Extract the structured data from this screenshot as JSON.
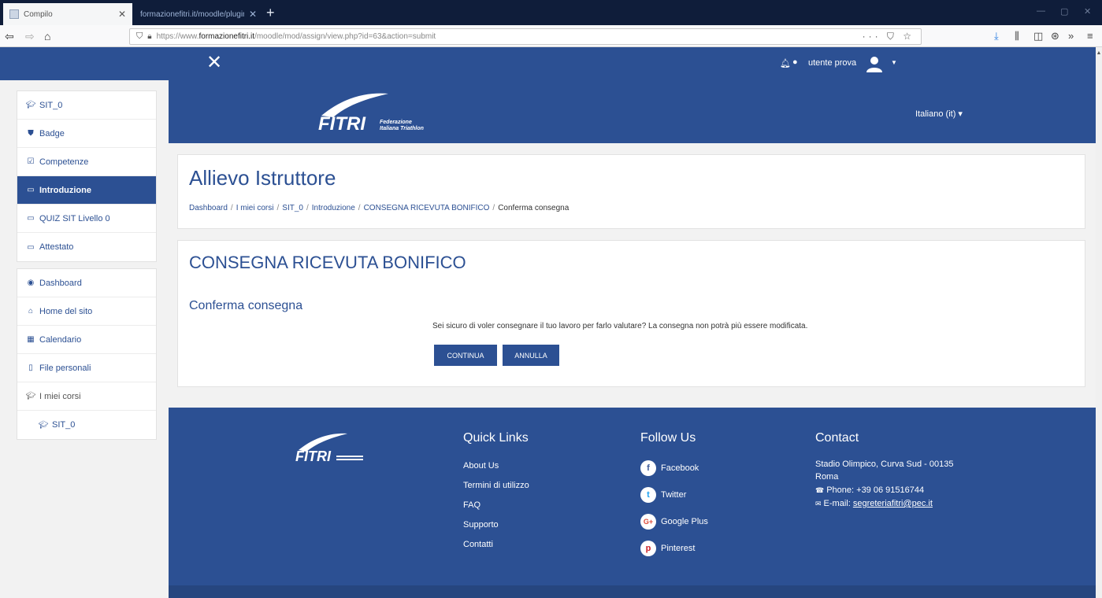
{
  "browser": {
    "tabs": [
      {
        "label": "Compilo"
      },
      {
        "label": "formazionefitri.it/moodle/plugin/..."
      }
    ],
    "url_prefix": "https://www.",
    "url_host": "formazionefitri.it",
    "url_path": "/moodle/mod/assign/view.php?id=63&action=submit"
  },
  "topbar": {
    "user_name": "utente prova"
  },
  "sidebar": {
    "course_items": [
      {
        "label": "SIT_0",
        "icon": "graduation-cap-icon"
      },
      {
        "label": "Badge",
        "icon": "shield-icon"
      },
      {
        "label": "Competenze",
        "icon": "checkbox-icon"
      },
      {
        "label": "Introduzione",
        "icon": "folder-icon",
        "active": true
      },
      {
        "label": "QUIZ SIT Livello 0",
        "icon": "folder-icon"
      },
      {
        "label": "Attestato",
        "icon": "folder-icon"
      }
    ],
    "site_items": [
      {
        "label": "Dashboard",
        "icon": "dashboard-icon"
      },
      {
        "label": "Home del sito",
        "icon": "home-icon"
      },
      {
        "label": "Calendario",
        "icon": "calendar-icon"
      },
      {
        "label": "File personali",
        "icon": "file-icon"
      },
      {
        "label": "I miei corsi",
        "icon": "graduation-cap-icon"
      },
      {
        "label": "SIT_0",
        "icon": "graduation-cap-icon"
      }
    ]
  },
  "banner": {
    "language": "Italiano (it)"
  },
  "header": {
    "title": "Allievo Istruttore",
    "breadcrumb": [
      "Dashboard",
      "I miei corsi",
      "SIT_0",
      "Introduzione",
      "CONSEGNA RICEVUTA BONIFICO",
      "Conferma consegna"
    ]
  },
  "main": {
    "heading": "CONSEGNA RICEVUTA BONIFICO",
    "subheading": "Conferma consegna",
    "confirm_text": "Sei sicuro di voler consegnare il tuo lavoro per farlo valutare? La consegna non potrà più essere modificata.",
    "continue_label": "CONTINUA",
    "cancel_label": "ANNULLA"
  },
  "footer": {
    "quick_links_title": "Quick Links",
    "quick_links": [
      "About Us",
      "Termini di utilizzo",
      "FAQ",
      "Supporto",
      "Contatti"
    ],
    "follow_title": "Follow Us",
    "social": [
      {
        "label": "Facebook",
        "glyph": "f",
        "color": "#3b5998"
      },
      {
        "label": "Twitter",
        "glyph": "t",
        "color": "#1da1f2"
      },
      {
        "label": "Google Plus",
        "glyph": "G+",
        "color": "#dd4b39"
      },
      {
        "label": "Pinterest",
        "glyph": "p",
        "color": "#cb2027"
      }
    ],
    "contact_title": "Contact",
    "address_line1": "Stadio Olimpico, Curva Sud - 00135",
    "address_line2": "Roma",
    "phone": "Phone: +39 06 91516744",
    "email_label": "E-mail:",
    "email": "segreteriafitri@pec.it"
  },
  "colors": {
    "primary": "#2c5093",
    "page_bg": "#f2f2f2"
  }
}
